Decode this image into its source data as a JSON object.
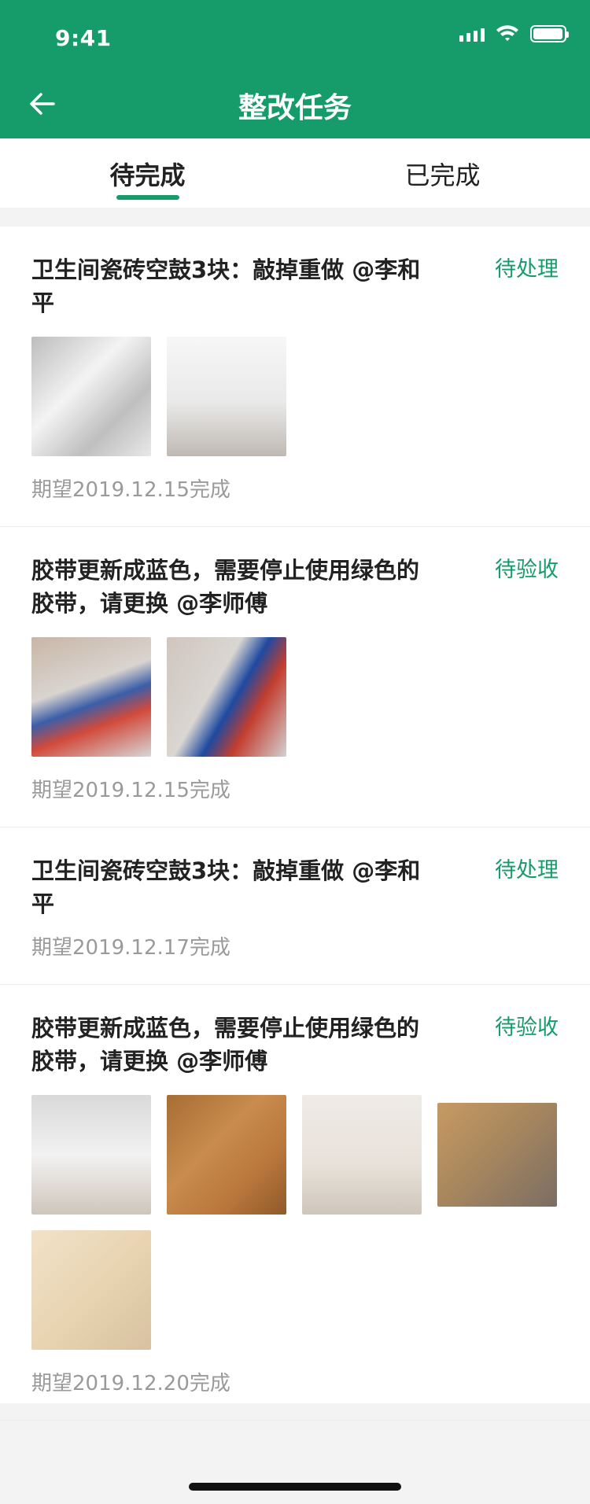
{
  "status_bar": {
    "time": "9:41"
  },
  "header": {
    "title": "整改任务"
  },
  "tabs": [
    {
      "label": "待完成",
      "active": true
    },
    {
      "label": "已完成",
      "active": false
    }
  ],
  "tasks": [
    {
      "title": "卫生间瓷砖空鼓3块：敲掉重做 @李和平",
      "status": "待处理",
      "due": "期望2019.12.15完成",
      "photos": [
        "bathroom-photo-1",
        "bathroom-photo-2"
      ]
    },
    {
      "title": "胶带更新成蓝色，需要停止使用绿色的胶带，请更换 @李师傅",
      "status": "待验收",
      "due": "期望2019.12.15完成",
      "photos": [
        "pipes-photo-1",
        "pipes-photo-2"
      ]
    },
    {
      "title": "卫生间瓷砖空鼓3块：敲掉重做 @李和平",
      "status": "待处理",
      "due": "期望2019.12.17完成",
      "photos": []
    },
    {
      "title": "胶带更新成蓝色，需要停止使用绿色的胶带，请更换 @李师傅",
      "status": "待验收",
      "due": "期望2019.12.20完成",
      "photos": [
        "room-photo",
        "wood-floor-photo",
        "white-room-photo",
        "floor-sample-photo",
        "wood-planks-photo"
      ]
    }
  ],
  "colors": {
    "brand": "#169b6a",
    "text": "#222222",
    "muted": "#9a9a9a"
  }
}
